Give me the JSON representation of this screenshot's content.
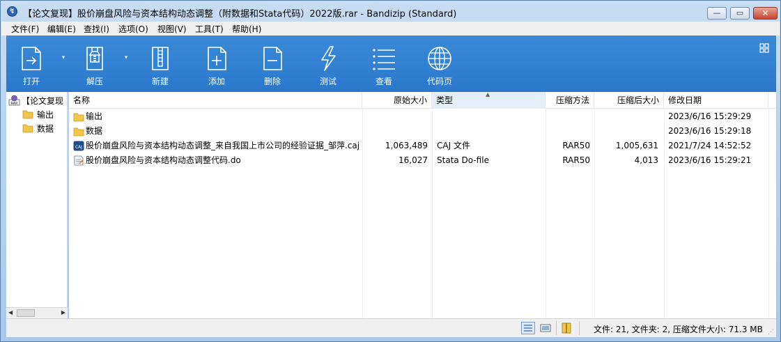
{
  "window": {
    "title": "【论文复现】股价崩盘风险与资本结构动态调整（附数据和Stata代码）2022版.rar - Bandizip (Standard)",
    "min_glyph": "▭",
    "max_glyph": "▭",
    "close_glyph": "✕"
  },
  "menu": [
    {
      "label": "文件(F)"
    },
    {
      "label": "编辑(E)"
    },
    {
      "label": "查找(I)"
    },
    {
      "label": "选项(O)"
    },
    {
      "label": "视图(V)"
    },
    {
      "label": "工具(T)"
    },
    {
      "label": "帮助(H)"
    }
  ],
  "toolbar": [
    {
      "label": "打开",
      "icon": "open-archive-icon"
    },
    {
      "label": "解压",
      "icon": "extract-zipper-icon"
    },
    {
      "label": "新建",
      "icon": "new-archive-icon"
    },
    {
      "label": "添加",
      "icon": "add-file-icon"
    },
    {
      "label": "删除",
      "icon": "delete-file-icon"
    },
    {
      "label": "测试",
      "icon": "test-lightning-icon"
    },
    {
      "label": "查看",
      "icon": "view-list-icon"
    },
    {
      "label": "代码页",
      "icon": "globe-icon"
    }
  ],
  "tree": {
    "root": "【论文复现",
    "children": [
      "输出",
      "数据"
    ]
  },
  "columns": [
    "名称",
    "原始大小",
    "类型",
    "压缩方法",
    "压缩后大小",
    "修改日期"
  ],
  "files": [
    {
      "name": "输出",
      "size": "",
      "type": "",
      "method": "",
      "packed": "",
      "date": "2023/6/16 15:29:29",
      "icon": "folder-icon"
    },
    {
      "name": "数据",
      "size": "",
      "type": "",
      "method": "",
      "packed": "",
      "date": "2023/6/16 15:29:18",
      "icon": "folder-icon"
    },
    {
      "name": "股价崩盘风险与资本结构动态调整_来自我国上市公司的经验证据_邹萍.caj",
      "size": "1,063,489",
      "type": "CAJ 文件",
      "method": "RAR50",
      "packed": "1,005,631",
      "date": "2021/7/24 14:52:52",
      "icon": "caj-file-icon"
    },
    {
      "name": "股价崩盘风险与资本结构动态调整代码.do",
      "size": "16,027",
      "type": "Stata Do-file",
      "method": "RAR50",
      "packed": "4,013",
      "date": "2023/6/16 15:29:21",
      "icon": "do-file-icon"
    }
  ],
  "status": {
    "summary": "文件: 21, 文件夹: 2, 压缩文件大小: 71.3 MB"
  },
  "colors": {
    "toolbar": "#2f80d2",
    "window_frame": "#b9d3ee"
  }
}
